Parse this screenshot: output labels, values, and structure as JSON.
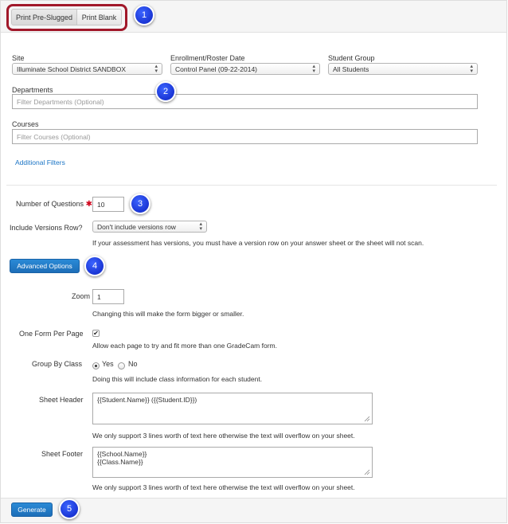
{
  "print_tabs": {
    "pre_slugged": "Print Pre-Slugged",
    "blank": "Print Blank"
  },
  "callouts": [
    "1",
    "2",
    "3",
    "4",
    "5"
  ],
  "filters": {
    "site": {
      "label": "Site",
      "value": "Illuminate School District SANDBOX"
    },
    "enrollment": {
      "label": "Enrollment/Roster Date",
      "value": "Control Panel (09-22-2014)"
    },
    "student_group": {
      "label": "Student Group",
      "value": "All Students"
    },
    "departments": {
      "label": "Departments",
      "placeholder": "Filter Departments (Optional)"
    },
    "courses": {
      "label": "Courses",
      "placeholder": "Filter Courses (Optional)"
    },
    "additional_filters": "Additional Filters"
  },
  "questions": {
    "label": "Number of Questions",
    "required_mark": "✱",
    "value": "10"
  },
  "versions": {
    "label": "Include Versions Row?",
    "value": "Don't include versions row",
    "help": "If your assessment has versions, you must have a version row on your answer sheet or the sheet will not scan."
  },
  "advanced_button": "Advanced Options",
  "zoom": {
    "label": "Zoom",
    "value": "1",
    "help": "Changing this will make the form bigger or smaller."
  },
  "one_form": {
    "label": "One Form Per Page",
    "checked": true,
    "check_glyph": "✔",
    "help": "Allow each page to try and fit more than one GradeCam form."
  },
  "group_by_class": {
    "label": "Group By Class",
    "yes": "Yes",
    "no": "No",
    "selected": "Yes",
    "help": "Doing this will include class information for each student."
  },
  "sheet_header": {
    "label": "Sheet Header",
    "value": "{{Student.Name}} ({{Student.ID}})",
    "help": "We only support 3 lines worth of text here otherwise the text will overflow on your sheet."
  },
  "sheet_footer": {
    "label": "Sheet Footer",
    "line1": "{{School.Name}}",
    "line2": "{{Class.Name}}",
    "help": "We only support 3 lines worth of text here otherwise the text will overflow on your sheet."
  },
  "generate_button": "Generate",
  "colors": {
    "primary_blue": "#1d6eb8",
    "callout_blue": "#1a35d4",
    "highlight_red": "#a1182a",
    "link_blue": "#1a74c5",
    "required_red": "#d0021b"
  },
  "icons": {
    "select_arrows": "updown-arrows-icon",
    "resize": "resize-grip-icon"
  }
}
